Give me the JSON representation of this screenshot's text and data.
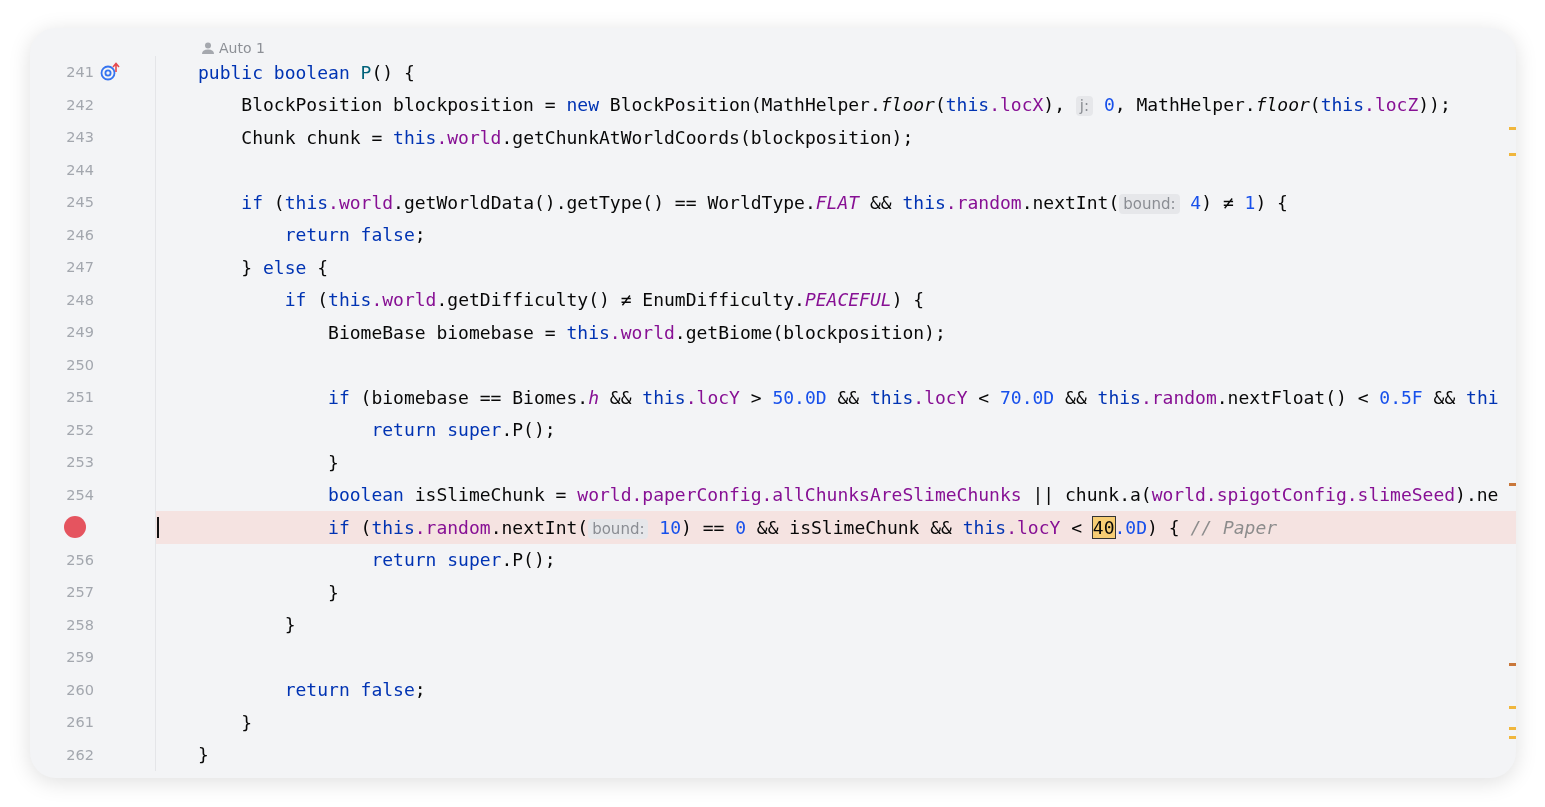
{
  "author_hint": {
    "text": "Auto 1"
  },
  "lines": [
    {
      "number": "241",
      "breakpoint": false,
      "overrides": true,
      "tokens": [
        {
          "kind": "kw",
          "text": "public boolean "
        },
        {
          "kind": "decl",
          "text": "P"
        },
        {
          "kind": "plain",
          "text": "() {"
        }
      ]
    },
    {
      "number": "242",
      "breakpoint": false,
      "overrides": false,
      "tokens": [
        {
          "kind": "plain",
          "text": "    BlockPosition blockposition = "
        },
        {
          "kind": "kw",
          "text": "new"
        },
        {
          "kind": "plain",
          "text": " BlockPosition(MathHelper."
        },
        {
          "kind": "fn",
          "text": "floor"
        },
        {
          "kind": "plain",
          "text": "("
        },
        {
          "kind": "kw",
          "text": "this"
        },
        {
          "kind": "field",
          "text": ".locX"
        },
        {
          "kind": "plain",
          "text": "), "
        },
        {
          "kind": "hint",
          "text": "j:"
        },
        {
          "kind": "num",
          "text": " 0"
        },
        {
          "kind": "plain",
          "text": ", MathHelper."
        },
        {
          "kind": "fn",
          "text": "floor"
        },
        {
          "kind": "plain",
          "text": "("
        },
        {
          "kind": "kw",
          "text": "this"
        },
        {
          "kind": "field",
          "text": ".locZ"
        },
        {
          "kind": "plain",
          "text": "));"
        }
      ]
    },
    {
      "number": "243",
      "breakpoint": false,
      "overrides": false,
      "tokens": [
        {
          "kind": "plain",
          "text": "    Chunk chunk = "
        },
        {
          "kind": "kw",
          "text": "this"
        },
        {
          "kind": "field",
          "text": ".world"
        },
        {
          "kind": "plain",
          "text": ".getChunkAtWorldCoords(blockposition);"
        }
      ]
    },
    {
      "number": "244",
      "breakpoint": false,
      "overrides": false
    },
    {
      "number": "245",
      "breakpoint": false,
      "overrides": false,
      "tokens": [
        {
          "kind": "kw",
          "text": "    if"
        },
        {
          "kind": "plain",
          "text": " ("
        },
        {
          "kind": "kw",
          "text": "this"
        },
        {
          "kind": "field",
          "text": ".world"
        },
        {
          "kind": "plain",
          "text": ".getWorldData().getType() == WorldType."
        },
        {
          "kind": "static",
          "text": "FLAT"
        },
        {
          "kind": "plain",
          "text": " && "
        },
        {
          "kind": "kw",
          "text": "this"
        },
        {
          "kind": "field",
          "text": ".random"
        },
        {
          "kind": "plain",
          "text": ".nextInt("
        },
        {
          "kind": "hint",
          "text": "bound:"
        },
        {
          "kind": "num",
          "text": " 4"
        },
        {
          "kind": "plain",
          "text": ") ≠ "
        },
        {
          "kind": "num",
          "text": "1"
        },
        {
          "kind": "plain",
          "text": ") {"
        }
      ]
    },
    {
      "number": "246",
      "breakpoint": false,
      "overrides": false,
      "tokens": [
        {
          "kind": "kw",
          "text": "        return false"
        },
        {
          "kind": "plain",
          "text": ";"
        }
      ]
    },
    {
      "number": "247",
      "breakpoint": false,
      "overrides": false,
      "tokens": [
        {
          "kind": "plain",
          "text": "    } "
        },
        {
          "kind": "kw",
          "text": "else"
        },
        {
          "kind": "plain",
          "text": " {"
        }
      ]
    },
    {
      "number": "248",
      "breakpoint": false,
      "overrides": false,
      "tokens": [
        {
          "kind": "kw",
          "text": "        if"
        },
        {
          "kind": "plain",
          "text": " ("
        },
        {
          "kind": "kw",
          "text": "this"
        },
        {
          "kind": "field",
          "text": ".world"
        },
        {
          "kind": "plain",
          "text": ".getDifficulty() ≠ EnumDifficulty."
        },
        {
          "kind": "static",
          "text": "PEACEFUL"
        },
        {
          "kind": "plain",
          "text": ") {"
        }
      ]
    },
    {
      "number": "249",
      "breakpoint": false,
      "overrides": false,
      "tokens": [
        {
          "kind": "plain",
          "text": "            BiomeBase biomebase = "
        },
        {
          "kind": "kw",
          "text": "this"
        },
        {
          "kind": "field",
          "text": ".world"
        },
        {
          "kind": "plain",
          "text": ".getBiome(blockposition);"
        }
      ]
    },
    {
      "number": "250",
      "breakpoint": false,
      "overrides": false
    },
    {
      "number": "251",
      "breakpoint": false,
      "overrides": false,
      "tokens": [
        {
          "kind": "kw",
          "text": "            if"
        },
        {
          "kind": "plain",
          "text": " (biomebase == Biomes."
        },
        {
          "kind": "static",
          "text": "h"
        },
        {
          "kind": "plain",
          "text": " && "
        },
        {
          "kind": "kw",
          "text": "this"
        },
        {
          "kind": "field",
          "text": ".locY"
        },
        {
          "kind": "plain",
          "text": " > "
        },
        {
          "kind": "num",
          "text": "50.0D"
        },
        {
          "kind": "plain",
          "text": " && "
        },
        {
          "kind": "kw",
          "text": "this"
        },
        {
          "kind": "field",
          "text": ".locY"
        },
        {
          "kind": "plain",
          "text": " < "
        },
        {
          "kind": "num",
          "text": "70.0D"
        },
        {
          "kind": "plain",
          "text": " && "
        },
        {
          "kind": "kw",
          "text": "this"
        },
        {
          "kind": "field",
          "text": ".random"
        },
        {
          "kind": "plain",
          "text": ".nextFloat() < "
        },
        {
          "kind": "num",
          "text": "0.5F"
        },
        {
          "kind": "plain",
          "text": " && "
        },
        {
          "kind": "kw",
          "text": "thi"
        }
      ]
    },
    {
      "number": "252",
      "breakpoint": false,
      "overrides": false,
      "tokens": [
        {
          "kind": "kw",
          "text": "                return super"
        },
        {
          "kind": "plain",
          "text": ".P();"
        }
      ]
    },
    {
      "number": "253",
      "breakpoint": false,
      "overrides": false,
      "tokens": [
        {
          "kind": "plain",
          "text": "            }"
        }
      ]
    },
    {
      "number": "254",
      "breakpoint": false,
      "overrides": false,
      "tokens": [
        {
          "kind": "kw",
          "text": "            boolean"
        },
        {
          "kind": "plain",
          "text": " isSlimeChunk = "
        },
        {
          "kind": "field",
          "text": "world.paperConfig.allChunksAreSlimeChunks"
        },
        {
          "kind": "plain",
          "text": " || chunk.a("
        },
        {
          "kind": "field",
          "text": "world.spigotConfig.slimeSeed"
        },
        {
          "kind": "plain",
          "text": ").ne"
        }
      ]
    },
    {
      "breakpoint": true,
      "overrides": false,
      "tokens": [
        {
          "kind": "kw",
          "text": "            if"
        },
        {
          "kind": "plain",
          "text": " ("
        },
        {
          "kind": "kw",
          "text": "this"
        },
        {
          "kind": "field",
          "text": ".random"
        },
        {
          "kind": "plain",
          "text": ".nextInt("
        },
        {
          "kind": "hint",
          "text": "bound:"
        },
        {
          "kind": "num",
          "text": " 10"
        },
        {
          "kind": "plain",
          "text": ") == "
        },
        {
          "kind": "num",
          "text": "0"
        },
        {
          "kind": "plain",
          "text": " && isSlimeChunk && "
        },
        {
          "kind": "kw",
          "text": "this"
        },
        {
          "kind": "field",
          "text": ".locY"
        },
        {
          "kind": "plain",
          "text": " < "
        },
        {
          "kind": "match",
          "text": "40"
        },
        {
          "kind": "num",
          "text": ".0D"
        },
        {
          "kind": "plain",
          "text": ") { "
        },
        {
          "kind": "comment",
          "text": "// Paper"
        }
      ]
    },
    {
      "number": "256",
      "breakpoint": false,
      "overrides": false,
      "tokens": [
        {
          "kind": "kw",
          "text": "                return super"
        },
        {
          "kind": "plain",
          "text": ".P();"
        }
      ]
    },
    {
      "number": "257",
      "breakpoint": false,
      "overrides": false,
      "tokens": [
        {
          "kind": "plain",
          "text": "            }"
        }
      ]
    },
    {
      "number": "258",
      "breakpoint": false,
      "overrides": false,
      "tokens": [
        {
          "kind": "plain",
          "text": "        }"
        }
      ]
    },
    {
      "number": "259",
      "breakpoint": false,
      "overrides": false
    },
    {
      "number": "260",
      "breakpoint": false,
      "overrides": false,
      "tokens": [
        {
          "kind": "kw",
          "text": "        return false"
        },
        {
          "kind": "plain",
          "text": ";"
        }
      ]
    },
    {
      "number": "261",
      "breakpoint": false,
      "overrides": false,
      "tokens": [
        {
          "kind": "plain",
          "text": "    }"
        }
      ]
    },
    {
      "number": "262",
      "breakpoint": false,
      "overrides": false,
      "tokens": [
        {
          "kind": "plain",
          "text": "}"
        }
      ]
    }
  ]
}
